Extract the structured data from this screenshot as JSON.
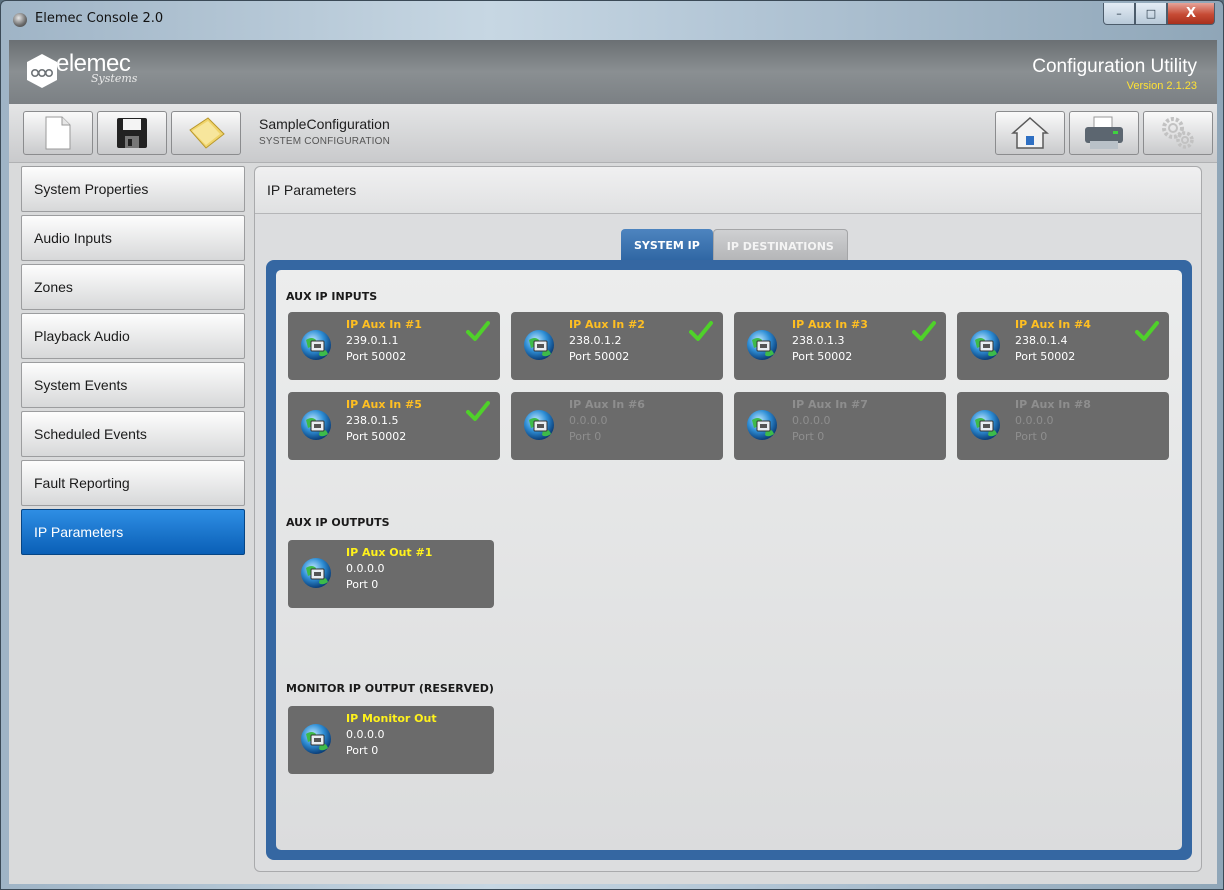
{
  "window": {
    "title": "Elemec Console 2.0",
    "minimize": "–",
    "maximize": "□",
    "close": "X"
  },
  "banner": {
    "logo": "elemec",
    "logo_sub": "Systems",
    "title": "Configuration Utility",
    "version": "Version 2.1.23"
  },
  "toolbar": {
    "icons": [
      "new-document-icon",
      "save-disk-icon",
      "open-folder-icon",
      "home-icon",
      "printer-icon",
      "settings-gears-icon"
    ],
    "config_name": "SampleConfiguration",
    "config_sub": "SYSTEM CONFIGURATION"
  },
  "sidebar": {
    "items": [
      {
        "label": "System Properties"
      },
      {
        "label": "Audio Inputs"
      },
      {
        "label": "Zones"
      },
      {
        "label": "Playback Audio"
      },
      {
        "label": "System Events"
      },
      {
        "label": "Scheduled Events"
      },
      {
        "label": "Fault Reporting"
      },
      {
        "label": "IP Parameters",
        "active": true
      }
    ]
  },
  "main": {
    "header": "IP Parameters",
    "tabs": [
      {
        "label": "SYSTEM IP",
        "active": true
      },
      {
        "label": "IP DESTINATIONS",
        "active": false
      }
    ]
  },
  "panel": {
    "aux_inputs_title": "AUX IP INPUTS",
    "aux_outputs_title": "AUX IP OUTPUTS",
    "monitor_title": "MONITOR IP OUTPUT (RESERVED)",
    "aux_inputs": [
      {
        "name": "IP Aux In #1",
        "ip": "239.0.1.1",
        "port": "Port 50002",
        "active": true
      },
      {
        "name": "IP Aux In #2",
        "ip": "238.0.1.2",
        "port": "Port 50002",
        "active": true
      },
      {
        "name": "IP Aux In #3",
        "ip": "238.0.1.3",
        "port": "Port 50002",
        "active": true
      },
      {
        "name": "IP Aux In #4",
        "ip": "238.0.1.4",
        "port": "Port 50002",
        "active": true
      },
      {
        "name": "IP Aux In #5",
        "ip": "238.0.1.5",
        "port": "Port 50002",
        "active": true
      },
      {
        "name": "IP Aux In #6",
        "ip": "0.0.0.0",
        "port": "Port 0",
        "active": false
      },
      {
        "name": "IP Aux In #7",
        "ip": "0.0.0.0",
        "port": "Port 0",
        "active": false
      },
      {
        "name": "IP Aux In #8",
        "ip": "0.0.0.0",
        "port": "Port 0",
        "active": false
      }
    ],
    "aux_outputs": [
      {
        "name": "IP Aux Out #1",
        "ip": "0.0.0.0",
        "port": "Port 0"
      }
    ],
    "monitor_outputs": [
      {
        "name": "IP Monitor Out",
        "ip": "0.0.0.0",
        "port": "Port 0"
      }
    ]
  },
  "colors": {
    "accent": "#0a5fb6",
    "panel_frame": "#3567a2",
    "card_bg": "#6b6b6b",
    "name_orange": "#ffbf22",
    "name_yellow": "#fff21c",
    "check_green": "#4fd12a"
  }
}
